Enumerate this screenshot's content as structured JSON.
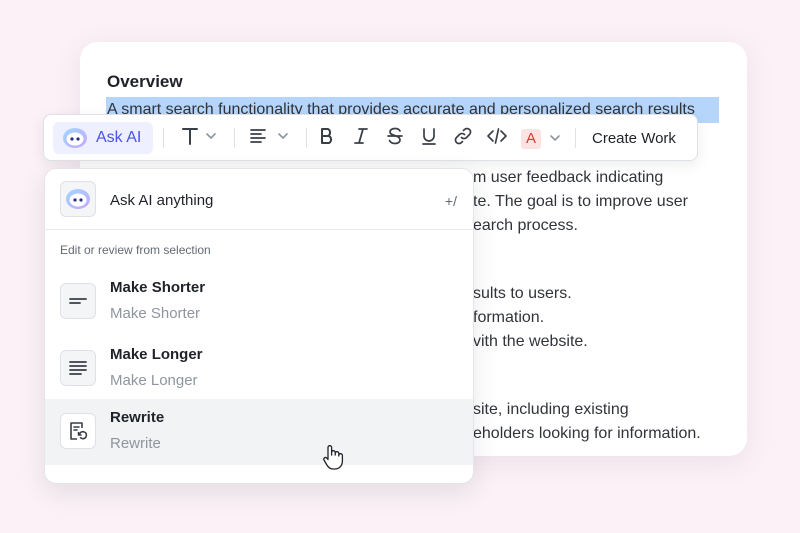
{
  "document": {
    "title": "Overview",
    "selected_text": "A smart search functionality that provides accurate and personalized search results",
    "lines": [
      "m user feedback indicating",
      "te. The goal is to improve user",
      "earch process.",
      "sults to users.",
      "formation.",
      "vith the website.",
      "site, including existing",
      "eholders looking for information."
    ]
  },
  "toolbar": {
    "ask_ai_label": "Ask AI",
    "create_work_label": "Create Work",
    "icons": [
      "bot-icon",
      "text-style-icon",
      "align-icon",
      "bold-icon",
      "italic-icon",
      "strikethrough-icon",
      "underline-icon",
      "link-icon",
      "code-icon",
      "text-color-icon"
    ],
    "text_color_glyph": "A",
    "accent_color": "#4a52e6",
    "highlight_color": "#b5d5fb"
  },
  "ai_menu": {
    "ask_label": "Ask AI anything",
    "shortcut": "+/",
    "section_label": "Edit or review from selection",
    "items": [
      {
        "title": "Make Shorter",
        "subtitle": "Make Shorter",
        "icon": "short-lines-icon"
      },
      {
        "title": "Make Longer",
        "subtitle": "Make Longer",
        "icon": "long-lines-icon"
      },
      {
        "title": "Rewrite",
        "subtitle": "Rewrite",
        "icon": "rewrite-icon"
      }
    ]
  }
}
